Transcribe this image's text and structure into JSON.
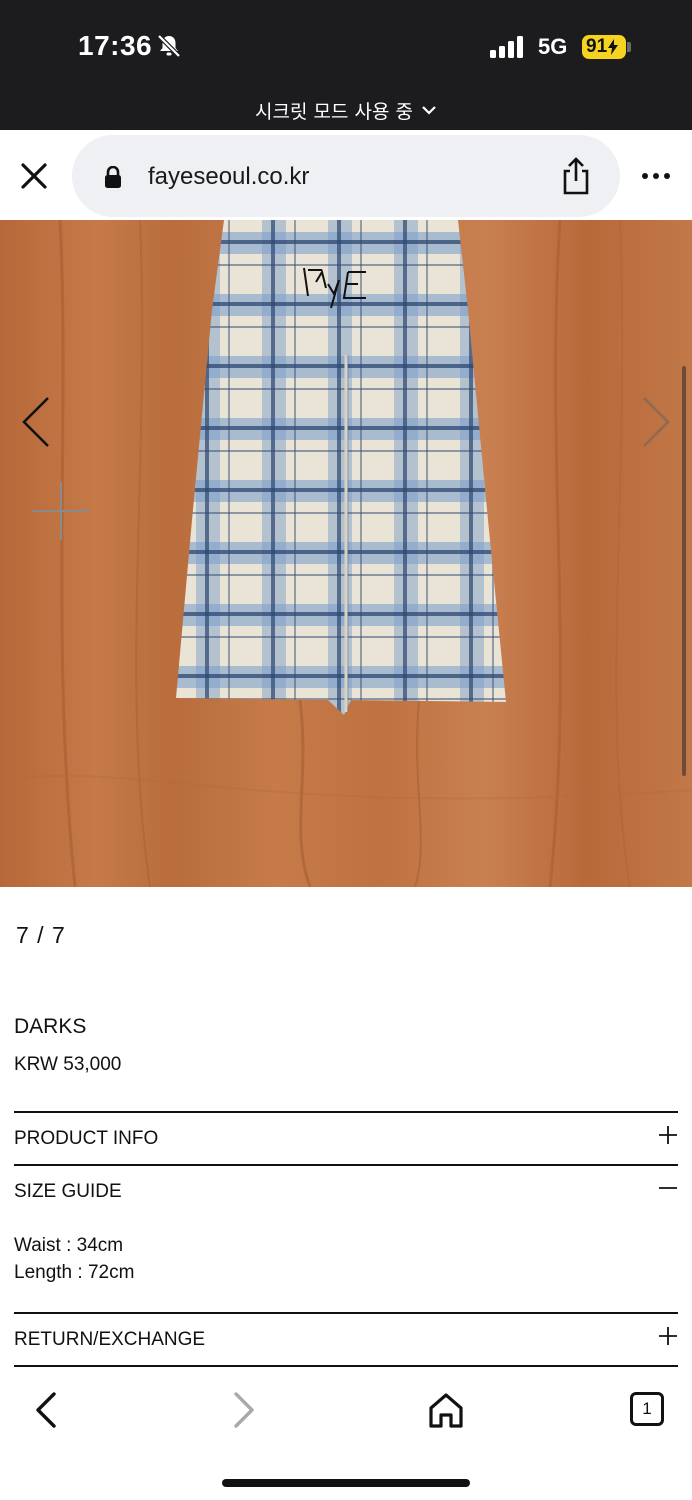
{
  "status_bar": {
    "time": "17:36",
    "network": "5G",
    "battery": "91",
    "icons": [
      "bell-slash-icon",
      "signal-icon",
      "battery-charging-icon"
    ]
  },
  "private_mode": {
    "label": "시크릿 모드 사용 중"
  },
  "browser": {
    "url": "fayeseoul.co.kr",
    "icons": [
      "close-icon",
      "lock-icon",
      "share-icon",
      "more-icon"
    ]
  },
  "product": {
    "image_counter": "7 / 7",
    "name": "DARKS",
    "price": "KRW 53,000",
    "image_icons": [
      "plus-icon",
      "chevron-left-icon",
      "chevron-right-icon"
    ],
    "sections": [
      {
        "title": "PRODUCT INFO",
        "state": "collapsed"
      },
      {
        "title": "SIZE GUIDE",
        "state": "expanded",
        "content": [
          "Waist : 34cm",
          "Length : 72cm"
        ]
      },
      {
        "title": "RETURN/EXCHANGE",
        "state": "collapsed"
      }
    ]
  },
  "toolbar": {
    "tab_count": "1",
    "icons": [
      "back-icon",
      "forward-icon",
      "home-icon",
      "tabs-icon"
    ]
  },
  "colors": {
    "status_bar_bg": "#1c1c1e",
    "battery": "#f5d320",
    "url_pill": "#eef0f3"
  }
}
